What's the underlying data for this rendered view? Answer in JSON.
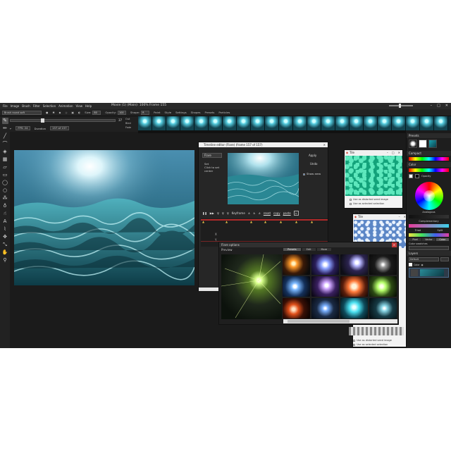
{
  "app": {
    "title": "Movie (1) (Main): 100% Frame 155",
    "menu": [
      "File",
      "Image",
      "Brush",
      "Filter",
      "Selection",
      "Animation",
      "View",
      "Help"
    ]
  },
  "toolbar": {
    "brush_preset": "Brush round soft",
    "size_label": "Size:",
    "size_value": "80",
    "opacity_label": "Opacity:",
    "opacity_value": "100",
    "shape_label": "Shape:",
    "shape_value": "R",
    "mode_label": "Paint",
    "style_label": "Style",
    "items": [
      "Settings",
      "Shapes",
      "Presets",
      "Particles"
    ]
  },
  "timeline": {
    "frame_value": "37",
    "fps_label": "FPS: 24",
    "duration_label": "Duration",
    "frame_counter": "157 of 157",
    "row_labels": [
      "Out",
      "Bled",
      "Fade"
    ]
  },
  "effects_window": {
    "title": "Timeline editor (Flare) (frame 157 of 157)",
    "select_value": "Flare",
    "hint_lines": [
      "Set",
      "Click to set",
      "center"
    ],
    "apply": "Apply",
    "undo": "Undo",
    "show_area": "Show area",
    "keyframe_label": "Keyframe",
    "tl_links": [
      "reset",
      "copy",
      "paste"
    ],
    "axis_labels": [
      "X",
      "Y"
    ]
  },
  "flare_window": {
    "title": "Flare options",
    "preview_label": "Preview",
    "tabs": [
      "Presets",
      "Edit",
      "More"
    ]
  },
  "texture_window_1": {
    "title": "Tile",
    "options": [
      "Use as distorted seed image",
      "Use as selected selection"
    ]
  },
  "texture_window_2": {
    "title": "Tile",
    "options": [
      "Use as distorted seed image",
      "Use as selected selection"
    ]
  },
  "right_panel": {
    "presets_head": "Presets",
    "compact_head": "Compact",
    "color_head": "Color",
    "opacity_label": "Opacity",
    "analogous": "Analogous",
    "complementary": "Complementary",
    "triad": "Triad",
    "split": "Split",
    "tabs": [
      "Pixel",
      "Vector",
      "Color"
    ],
    "color_swatches": "Color swatches",
    "layers_head": "Layers",
    "layer_mode": "Default",
    "layer_name": "Color"
  },
  "colors": {
    "bg": "#1b1b1b",
    "panel": "#262626",
    "accent": "#2b78d6",
    "water": "#2c8a96",
    "texture_green": "#1fb98c",
    "texture_blue": "#7aa8e6",
    "timeline_red": "#b02a2a"
  }
}
